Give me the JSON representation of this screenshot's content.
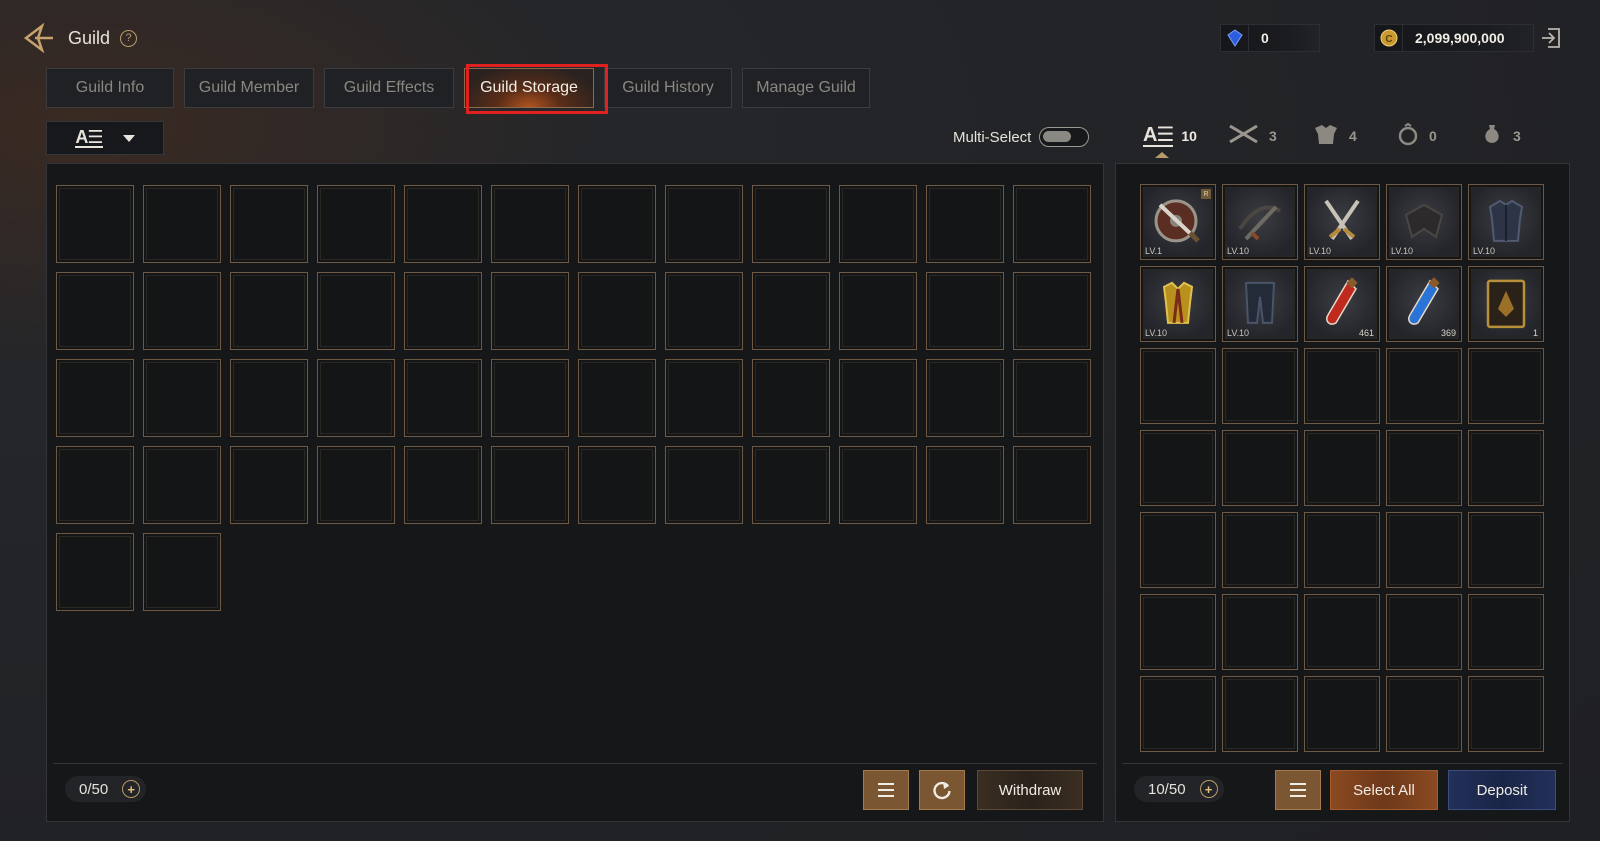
{
  "header": {
    "title": "Guild",
    "help_icon": "help-icon",
    "back_icon": "back-arrow-icon",
    "exit_icon": "exit-icon"
  },
  "currency": {
    "gem": {
      "icon": "blue-gem-icon",
      "value": "0"
    },
    "gold": {
      "icon": "gold-coin-icon",
      "value": "2,099,900,000"
    }
  },
  "tabs": [
    {
      "label": "Guild Info",
      "active": false
    },
    {
      "label": "Guild Member",
      "active": false
    },
    {
      "label": "Guild Effects",
      "active": false
    },
    {
      "label": "Guild Storage",
      "active": true
    },
    {
      "label": "Guild History",
      "active": false
    },
    {
      "label": "Manage Guild",
      "active": false
    }
  ],
  "filter": {
    "sort_icon": "sort-all-icon",
    "caret_icon": "caret-down-icon"
  },
  "multi_select": {
    "label": "Multi-Select",
    "enabled": false
  },
  "categories": [
    {
      "icon": "all-items-icon",
      "count": "10",
      "active": true
    },
    {
      "icon": "weapon-icon",
      "count": "3",
      "active": false
    },
    {
      "icon": "armor-icon",
      "count": "4",
      "active": false
    },
    {
      "icon": "accessory-ring-icon",
      "count": "0",
      "active": false
    },
    {
      "icon": "consumable-pouch-icon",
      "count": "3",
      "active": false
    }
  ],
  "storage": {
    "capacity": "0/50",
    "slots_shown": 50,
    "withdraw_label": "Withdraw",
    "menu_icon": "menu-icon",
    "refresh_icon": "refresh-icon"
  },
  "inventory": {
    "capacity": "10/50",
    "select_all_label": "Select All",
    "deposit_label": "Deposit",
    "menu_icon": "menu-icon",
    "items": [
      {
        "icon": "shield-sword-icon",
        "level": "LV.1",
        "qty": "",
        "badge": "R"
      },
      {
        "icon": "crossbow-icon",
        "level": "LV.10",
        "qty": "",
        "badge": ""
      },
      {
        "icon": "dual-daggers-icon",
        "level": "LV.10",
        "qty": "",
        "badge": ""
      },
      {
        "icon": "helmet-icon",
        "level": "LV.10",
        "qty": "",
        "badge": ""
      },
      {
        "icon": "body-armor-icon",
        "level": "LV.10",
        "qty": "",
        "badge": ""
      },
      {
        "icon": "gold-vest-icon",
        "level": "LV.10",
        "qty": "",
        "badge": ""
      },
      {
        "icon": "leg-armor-icon",
        "level": "LV.10",
        "qty": "",
        "badge": ""
      },
      {
        "icon": "red-potion-icon",
        "level": "",
        "qty": "461",
        "badge": ""
      },
      {
        "icon": "blue-potion-icon",
        "level": "",
        "qty": "369",
        "badge": ""
      },
      {
        "icon": "card-icon",
        "level": "",
        "qty": "1",
        "badge": ""
      }
    ],
    "slots_shown": 35
  }
}
